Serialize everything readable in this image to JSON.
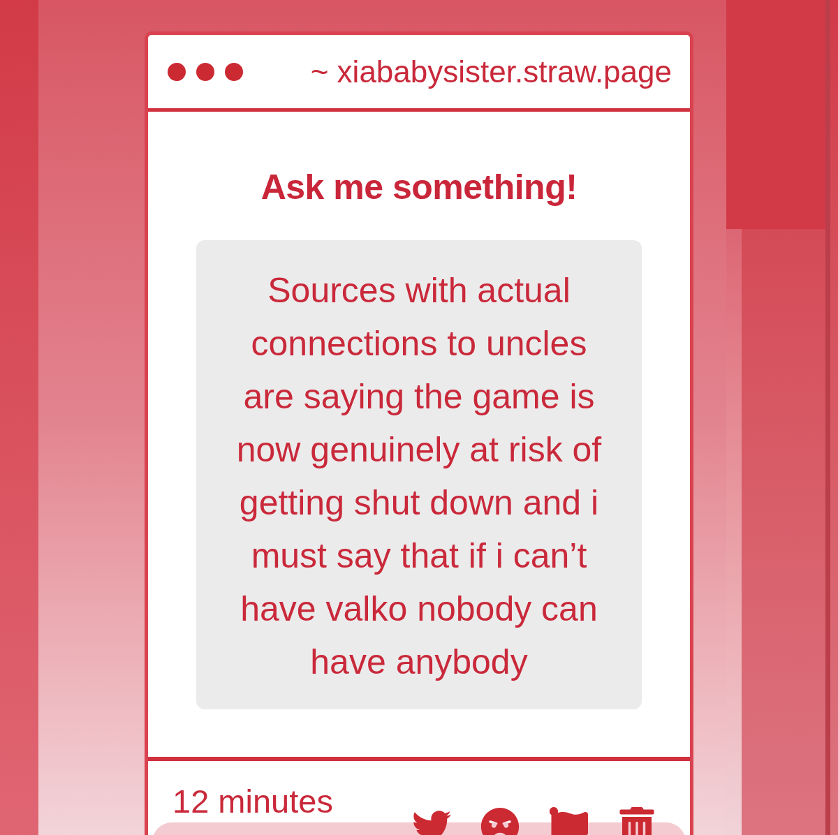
{
  "browser_bar": {
    "url": "~ xiababysister.straw.page"
  },
  "title": "Ask me something!",
  "question": "Sources with actual connections to uncles are saying the game is now genuinely at risk of getting shut down and i must say that if i can’t have valko nobody can have anybody",
  "footer": {
    "time": "12 minutes",
    "actions": [
      {
        "kind": "share"
      },
      {
        "kind": "react"
      },
      {
        "kind": "report"
      },
      {
        "kind": "delete"
      }
    ]
  }
}
